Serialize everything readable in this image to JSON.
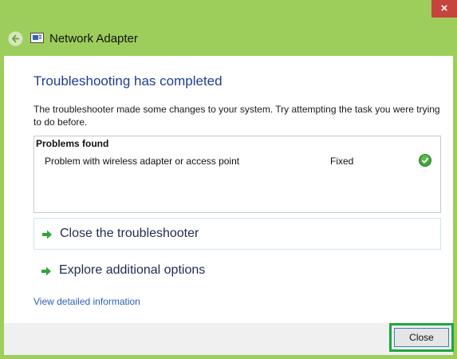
{
  "window": {
    "title": "Network Adapter",
    "close_glyph": "×"
  },
  "main": {
    "heading": "Troubleshooting has completed",
    "description": "The troubleshooter made some changes to your system. Try attempting the task you were trying to do before.",
    "problems": {
      "title": "Problems found",
      "items": [
        {
          "description": "Problem with wireless adapter or access point",
          "status": "Fixed",
          "icon": "green-check-icon"
        }
      ]
    },
    "actions": [
      {
        "label": "Close the troubleshooter",
        "icon": "green-arrow-icon"
      },
      {
        "label": "Explore additional options",
        "icon": "green-arrow-icon"
      }
    ],
    "detail_link": "View detailed information"
  },
  "footer": {
    "close_label": "Close"
  },
  "colors": {
    "window_frame": "#9dce5c",
    "heading": "#1f3d8f",
    "link": "#2b5fb7",
    "highlight": "#1ea641"
  }
}
